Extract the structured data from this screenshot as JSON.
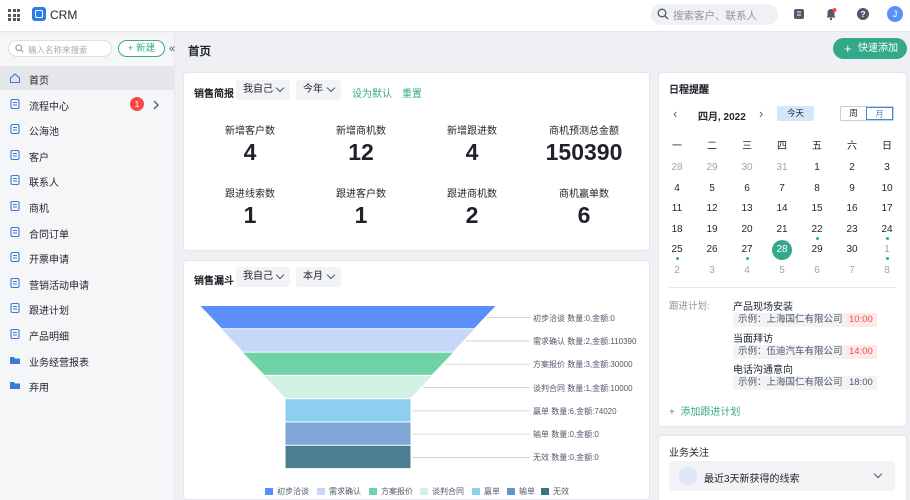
{
  "topbar": {
    "app_name": "CRM",
    "search_placeholder": "搜索客户、联系人",
    "avatar_initial": "J"
  },
  "sidebar": {
    "search_placeholder": "输入名称来搜索",
    "new_label": "+ 新建",
    "items": [
      {
        "label": "首页",
        "icon": "home-icon",
        "active": true
      },
      {
        "label": "流程中心",
        "icon": "flow-icon",
        "badge": "1",
        "has_chevron": true
      },
      {
        "label": "公海池",
        "icon": "pool-icon"
      },
      {
        "label": "客户",
        "icon": "customer-icon"
      },
      {
        "label": "联系人",
        "icon": "contact-icon"
      },
      {
        "label": "商机",
        "icon": "opportunity-icon"
      },
      {
        "label": "合同订单",
        "icon": "contract-icon"
      },
      {
        "label": "开票申请",
        "icon": "invoice-icon"
      },
      {
        "label": "营销活动申请",
        "icon": "campaign-icon"
      },
      {
        "label": "跟进计划",
        "icon": "plan-icon"
      },
      {
        "label": "产品明细",
        "icon": "product-icon"
      },
      {
        "label": "业务经营报表",
        "icon": "folder-icon"
      },
      {
        "label": "弃用",
        "icon": "folder-icon"
      }
    ]
  },
  "header": {
    "title": "首页",
    "quick_add": "快速添加"
  },
  "sales_brief": {
    "title": "销售简报",
    "owner_select": "我自己",
    "period_select": "今年",
    "set_default": "设为默认",
    "reset": "重置",
    "stats": [
      {
        "label": "新增客户数",
        "value": "4"
      },
      {
        "label": "新增商机数",
        "value": "12"
      },
      {
        "label": "新增跟进数",
        "value": "4"
      },
      {
        "label": "商机预测总金额",
        "value": "150390"
      },
      {
        "label": "跟进线索数",
        "value": "1"
      },
      {
        "label": "跟进客户数",
        "value": "1"
      },
      {
        "label": "跟进商机数",
        "value": "2"
      },
      {
        "label": "商机赢单数",
        "value": "6"
      }
    ]
  },
  "funnel": {
    "title": "销售漏斗",
    "owner_select": "我自己",
    "period_select": "本月",
    "labels": [
      "初步洽谈 数量:0,金额:0",
      "需求确认 数量:2,金额:110390",
      "方案报价 数量:3,金额:30000",
      "谈判合同 数量:1,金额:10000",
      "赢单 数量:6,金额:74020",
      "输单 数量:0,金额:0",
      "无效 数量:0,金额:0"
    ],
    "legend": [
      {
        "name": "初步洽谈",
        "color": "#5b8ff9"
      },
      {
        "name": "需求确认",
        "color": "#c6d8f7"
      },
      {
        "name": "方案报价",
        "color": "#6fd2a6"
      },
      {
        "name": "谈判合同",
        "color": "#d3f2e4"
      },
      {
        "name": "赢单",
        "color": "#8ccff0"
      },
      {
        "name": "输单",
        "color": "#5f96c8"
      },
      {
        "name": "无效",
        "color": "#3e7384"
      }
    ],
    "colors": [
      "#5b8ff9",
      "#c6d8f7",
      "#6fd2a6",
      "#d3f2e4",
      "#8ccff0",
      "#7ea7d6",
      "#4b7f90"
    ]
  },
  "calendar": {
    "title": "日程提醒",
    "month_label": "四月, 2022",
    "today_label": "今天",
    "view_week": "周",
    "view_month": "月",
    "weekdays": [
      "一",
      "二",
      "三",
      "四",
      "五",
      "六",
      "日"
    ],
    "weeks": [
      [
        "28",
        "29",
        "30",
        "31",
        "1",
        "2",
        "3"
      ],
      [
        "4",
        "5",
        "6",
        "7",
        "8",
        "9",
        "10"
      ],
      [
        "11",
        "12",
        "13",
        "14",
        "15",
        "16",
        "17"
      ],
      [
        "18",
        "19",
        "20",
        "21",
        "22",
        "23",
        "24"
      ],
      [
        "25",
        "26",
        "27",
        "28",
        "29",
        "30",
        "1"
      ],
      [
        "2",
        "3",
        "4",
        "5",
        "6",
        "7",
        "8"
      ]
    ],
    "today_date": "28"
  },
  "plans": {
    "heading": "跟进计划:",
    "items": [
      {
        "title": "产品现场安装",
        "example": "示例：上海国仁有限公司",
        "time": "10:00",
        "time_color": "#f54a45",
        "time_bg": "#fde9e8"
      },
      {
        "title": "当面拜访",
        "example": "示例：伍迪汽车有限公司",
        "time": "14:00",
        "time_color": "#f54a45",
        "time_bg": "#fde9e8"
      },
      {
        "title": "电话沟通意向",
        "example": "示例：上海国仁有限公司",
        "time": "18:00",
        "time_color": "#4e5969",
        "time_bg": "#f2f3f5"
      }
    ],
    "add_label": "添加跟进计划"
  },
  "business_focus": {
    "title": "业务关注",
    "row_label": "最近3天新获得的线索"
  }
}
